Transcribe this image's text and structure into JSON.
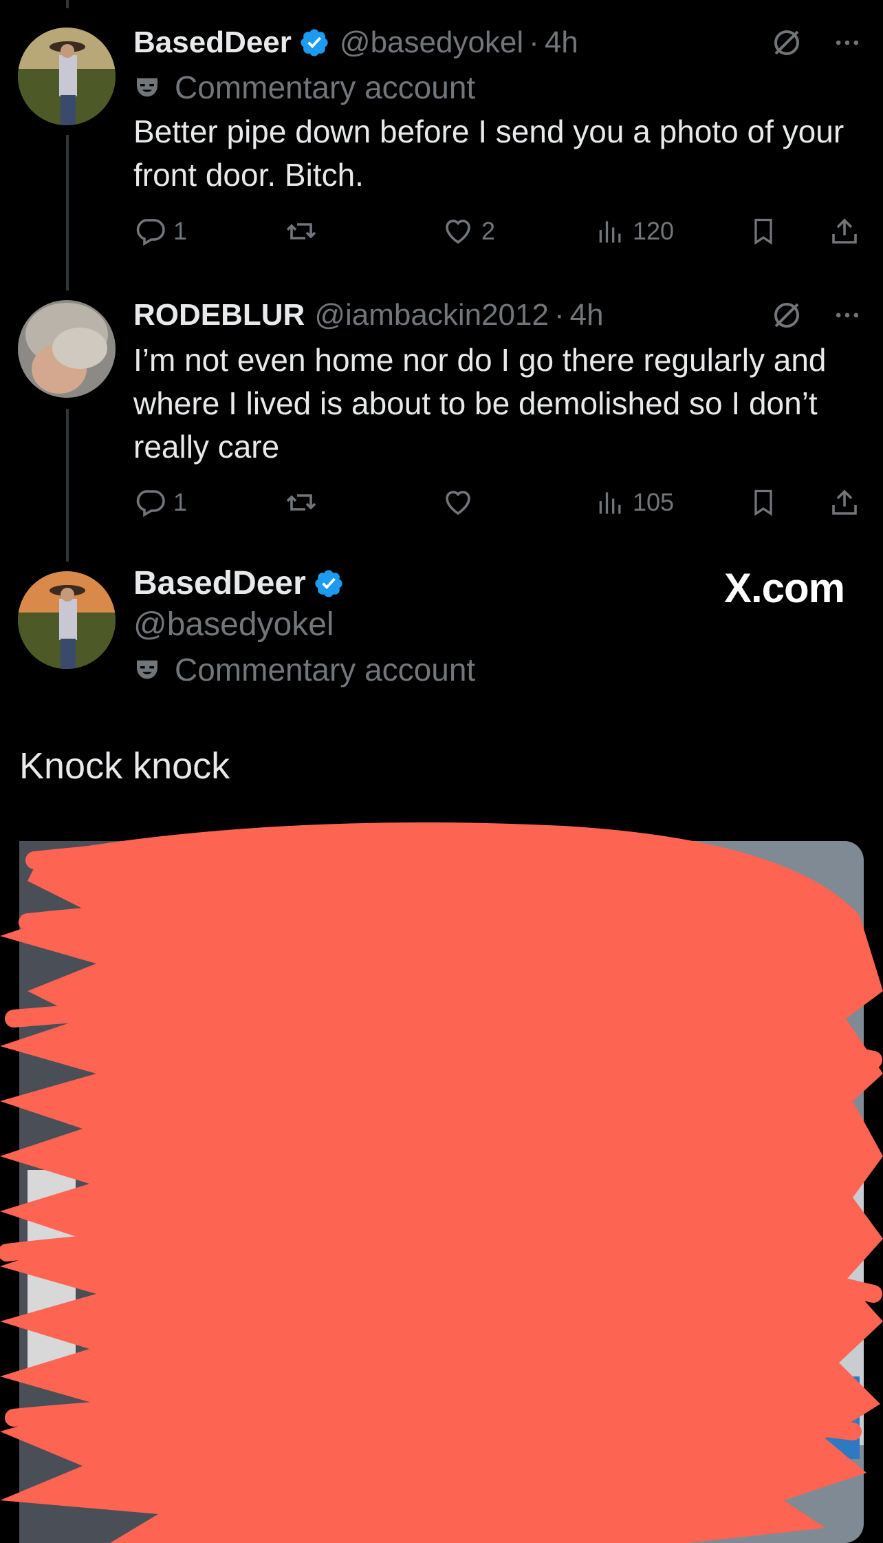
{
  "tweets": [
    {
      "name": "BasedDeer",
      "handle": "@basedyokel",
      "time": "4h",
      "label": "Commentary account",
      "text": "Better pipe down before I send you a photo of your front door. Bitch.",
      "replies": "1",
      "reposts": "",
      "likes": "2",
      "views": "120",
      "verified": true
    },
    {
      "name": "RODEBLUR",
      "handle": "@iambackin2012",
      "time": "4h",
      "text": "I’m not even home nor do I go there regularly and where I lived is about to be demolished so I don’t really care",
      "replies": "1",
      "reposts": "",
      "likes": "",
      "views": "105",
      "verified": false
    }
  ],
  "main_tweet": {
    "name": "BasedDeer",
    "handle": "@basedyokel",
    "label": "Commentary account",
    "text": "Knock knock",
    "source": "X.com",
    "verified": true
  },
  "colors": {
    "background": "#000000",
    "text": "#e7e9ea",
    "muted": "#71767b",
    "verified_blue": "#1d9bf0",
    "redaction": "#fd6452"
  },
  "icons": [
    "grok-icon",
    "more-icon",
    "reply-icon",
    "repost-icon",
    "like-icon",
    "views-icon",
    "bookmark-icon",
    "share-icon",
    "verified-icon",
    "commentary-mask-icon"
  ]
}
